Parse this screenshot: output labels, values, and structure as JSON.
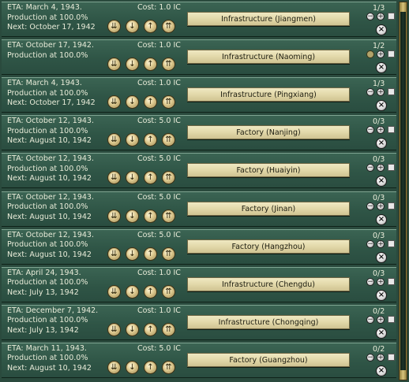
{
  "rows": [
    {
      "eta": "ETA: March 4, 1943.",
      "production": "Production at 100.0%",
      "next": "Next: October 17, 1942",
      "cost": "Cost: 1.0 IC",
      "name": "Infrastructure (Jiangmen)",
      "units": "1/3",
      "decrease_state": "enabled"
    },
    {
      "eta": "ETA: October 17, 1942.",
      "production": "Production at 100.0%",
      "next": "",
      "cost": "Cost: 1.0 IC",
      "name": "Infrastructure (Naoming)",
      "units": "1/2",
      "decrease_state": "disabled"
    },
    {
      "eta": "ETA: March 4, 1943.",
      "production": "Production at 100.0%",
      "next": "Next: October 17, 1942",
      "cost": "Cost: 1.0 IC",
      "name": "Infrastructure (Pingxiang)",
      "units": "1/3",
      "decrease_state": "enabled"
    },
    {
      "eta": "ETA: October 12, 1943.",
      "production": "Production at 100.0%",
      "next": "Next: August 10, 1942",
      "cost": "Cost: 5.0 IC",
      "name": "Factory (Nanjing)",
      "units": "0/3",
      "decrease_state": "enabled"
    },
    {
      "eta": "ETA: October 12, 1943.",
      "production": "Production at 100.0%",
      "next": "Next: August 10, 1942",
      "cost": "Cost: 5.0 IC",
      "name": "Factory (Huaiyin)",
      "units": "0/3",
      "decrease_state": "enabled"
    },
    {
      "eta": "ETA: October 12, 1943.",
      "production": "Production at 100.0%",
      "next": "Next: August 10, 1942",
      "cost": "Cost: 5.0 IC",
      "name": "Factory (Jinan)",
      "units": "0/3",
      "decrease_state": "enabled"
    },
    {
      "eta": "ETA: October 12, 1943.",
      "production": "Production at 100.0%",
      "next": "Next: August 10, 1942",
      "cost": "Cost: 5.0 IC",
      "name": "Factory (Hangzhou)",
      "units": "0/3",
      "decrease_state": "enabled"
    },
    {
      "eta": "ETA: April 24, 1943.",
      "production": "Production at 100.0%",
      "next": "Next: July 13, 1942",
      "cost": "Cost: 1.0 IC",
      "name": "Infrastructure (Chengdu)",
      "units": "0/3",
      "decrease_state": "enabled"
    },
    {
      "eta": "ETA: December 7, 1942.",
      "production": "Production at 100.0%",
      "next": "Next: July 13, 1942",
      "cost": "Cost: 1.0 IC",
      "name": "Infrastructure (Chongqing)",
      "units": "0/2",
      "decrease_state": "enabled"
    },
    {
      "eta": "ETA: March 11, 1943.",
      "production": "Production at 100.0%",
      "next": "Next: August 10, 1942",
      "cost": "Cost: 5.0 IC",
      "name": "Factory (Guangzhou)",
      "units": "0/2",
      "decrease_state": "enabled"
    }
  ],
  "icons": {
    "move_to_bottom": "move-to-bottom-icon",
    "move_down": "move-down-icon",
    "move_up": "move-up-icon",
    "move_to_top": "move-to-top-icon",
    "decrease": "minus-icon",
    "increase": "plus-icon",
    "delete": "delete-icon"
  },
  "colors": {
    "row_bg": "#2f5546",
    "name_bg": "#e2d8a9",
    "text": "#e9ecd9",
    "scrollbar": "#d8c47d"
  }
}
